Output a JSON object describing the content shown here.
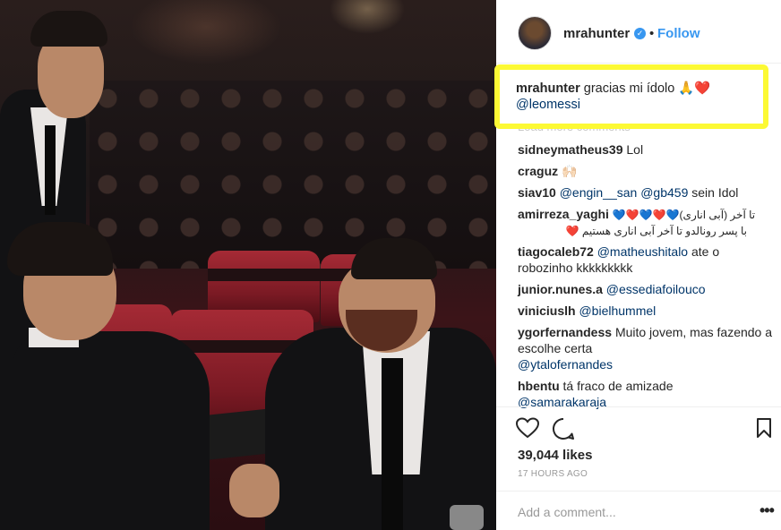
{
  "photo": {
    "alt": ""
  },
  "post": {
    "username": "mrahunter",
    "follow_label": "Follow",
    "separator": "•",
    "caption_user": "mrahunter",
    "caption_text": "gracias mi ídolo 🙏❤️",
    "caption_mention": "@leomessi",
    "load_more": "Load more comments",
    "likes": "39,044 likes",
    "time": "17 HOURS AGO",
    "add_comment_placeholder": "Add a comment...",
    "more_label": "•••"
  },
  "comments": [
    {
      "user": "sidneymatheus39",
      "text": "Lol",
      "mention": ""
    },
    {
      "user": "craguz",
      "text": "🙌🏻",
      "mention": ""
    },
    {
      "user": "siav10",
      "text": "sein Idol",
      "mention": "@engin__san @gb459"
    },
    {
      "user": "amirreza_yaghi",
      "text": "💙❤️💙❤️💙(آبی اناری) تا آخر",
      "text2": "با پسر رونالدو تا آخر آبی اناری هستیم ❤️",
      "mention": ""
    },
    {
      "user": "tiagocaleb72",
      "text": "ate o robozinho kkkkkkkkk",
      "mention": "@matheushitalo"
    },
    {
      "user": "junior.nunes.a",
      "text": "",
      "mention": "@essediafoilouco"
    },
    {
      "user": "viniciuslh",
      "text": "",
      "mention": "@bielhummel"
    },
    {
      "user": "ygorfernandess",
      "text": "Muito jovem, mas fazendo a escolhe certa",
      "mention": "@ytalofernandes"
    },
    {
      "user": "hbentu",
      "text": "tá fraco de amizade",
      "mention": "@samarakaraja"
    }
  ],
  "icons": [
    "heart-icon",
    "comment-icon",
    "bookmark-icon",
    "verified-icon"
  ],
  "colors": {
    "accent": "#3897f0",
    "highlight": "#fcf934",
    "link": "#003569"
  }
}
